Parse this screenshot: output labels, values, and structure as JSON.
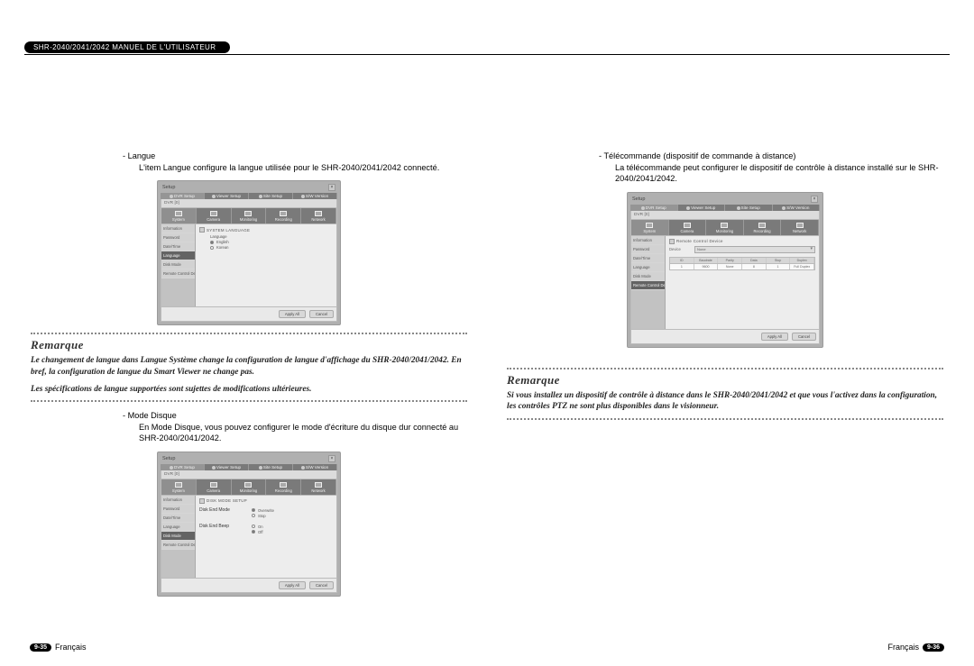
{
  "header": "SHR-2040/2041/2042 MANUEL DE L'UTILISATEUR",
  "left": {
    "sectionA": {
      "bullet": "- Langue",
      "desc": "L'item Langue configure la langue utilisée pour le SHR-2040/2041/2042 connecté."
    },
    "remarque": {
      "title": "Remarque",
      "p1": "Le changement de langue dans Langue Système change la configuration de langue d'affichage du SHR-2040/2041/2042. En bref, la configuration de langue du Smart Viewer ne change pas.",
      "p2": "Les spécifications de langue supportées sont sujettes de modifications ultérieures."
    },
    "sectionB": {
      "bullet": "- Mode Disque",
      "desc": "En Mode Disque, vous pouvez configurer le mode d'écriture du disque dur connecté au SHR-2040/2041/2042."
    }
  },
  "right": {
    "sectionA": {
      "bullet": "- Télécommande (dispositif de commande à distance)",
      "desc": "La télécommande peut configurer le dispositif de contrôle à distance installé sur le SHR-2040/2041/2042."
    },
    "remarque": {
      "title": "Remarque",
      "p1": "Si vous installez un dispositif de contrôle à distance dans le SHR-2040/2041/2042 et que vous l'activez dans la configuration, les contrôles PTZ ne sont plus disponibles dans le visionneur."
    }
  },
  "dvr_ui": {
    "window_title": "Setup",
    "top_tabs": [
      "DVR Setup",
      "Viewer Setup",
      "Site Setup",
      "S/W Version"
    ],
    "dropdown": "DVR [0]",
    "sub_tabs": [
      "System",
      "Camera",
      "Monitoring",
      "Recording",
      "Network"
    ],
    "side_items": [
      "Information",
      "Password",
      "Date/Time",
      "Language",
      "Disk Mode",
      "Remote Control Device"
    ],
    "apply": "Apply All",
    "cancel": "Cancel",
    "lang_panel": {
      "title": "SYSTEM LANGUAGE",
      "label": "Language",
      "options": [
        "English",
        "Korean"
      ]
    },
    "disk_panel": {
      "title": "DISK MODE SETUP",
      "row1_label": "Disk End Mode",
      "row1_opts": [
        "Overwrite",
        "Stop"
      ],
      "row2_label": "Disk End Beep",
      "row2_opts": [
        "On",
        "Off"
      ]
    },
    "remote_panel": {
      "title": "Remote Control Device",
      "device_label": "Device",
      "device_value": "None",
      "cols": [
        "ID",
        "Baudrate",
        "Parity",
        "Data",
        "Stop",
        "Duplex"
      ],
      "row": [
        "1",
        "9600",
        "None",
        "8",
        "1",
        "Full Duplex"
      ]
    }
  },
  "footer": {
    "left_num": "9-35",
    "left_lang": "Français",
    "right_lang": "Français",
    "right_num": "9-36"
  }
}
